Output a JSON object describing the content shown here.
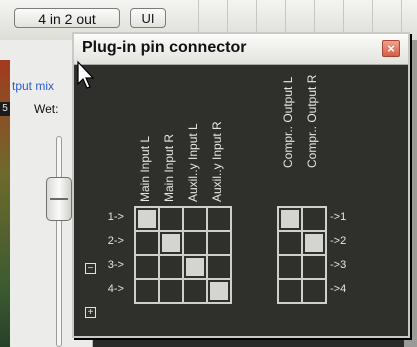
{
  "host": {
    "io_button_label": "4 in 2 out",
    "ui_button_label": "UI",
    "output_mix_label": "tput mix",
    "meter_value": "5",
    "wet_label": "Wet:"
  },
  "dialog": {
    "title": "Plug-in pin connector",
    "close_glyph": "×",
    "input_columns": [
      "Main Input L",
      "Main Input R",
      "Auxil..y Input L",
      "Auxil..y Input R"
    ],
    "output_columns": [
      "Compr.. Output L",
      "Compr.. Output R"
    ],
    "input_rows": [
      "1->",
      "2->",
      "3->",
      "4->"
    ],
    "output_rows": [
      "->1",
      "->2",
      "->3",
      "->4"
    ],
    "input_matrix_active": [
      [
        0,
        0
      ],
      [
        1,
        1
      ],
      [
        2,
        2
      ],
      [
        3,
        3
      ]
    ],
    "output_matrix_active": [
      [
        0,
        0
      ],
      [
        1,
        1
      ]
    ],
    "collapse_glyph": "−",
    "expand_glyph": "+"
  }
}
